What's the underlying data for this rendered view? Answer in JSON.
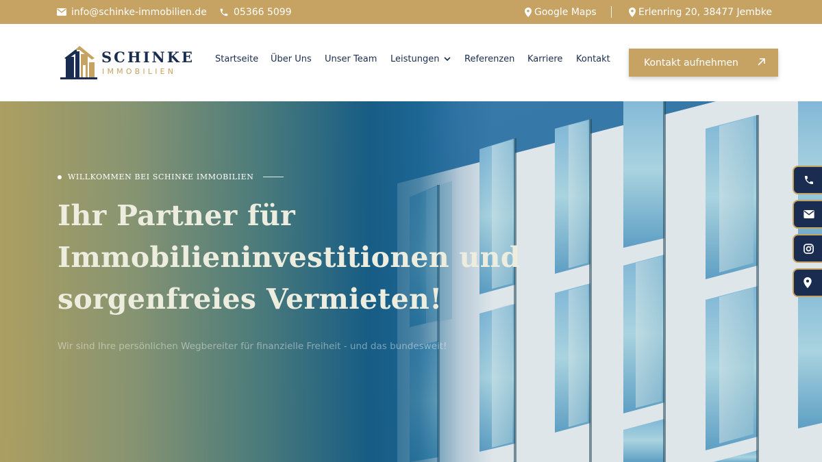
{
  "topbar": {
    "email": "info@schinke-immobilien.de",
    "phone": "05366 5099",
    "maps_label": "Google Maps",
    "address": "Erlenring 20, 38477 Jembke",
    "icons": {
      "email": "envelope-icon",
      "phone": "phone-icon",
      "maps": "map-pin-icon",
      "address": "map-pin-icon"
    }
  },
  "logo": {
    "name": "SCHINKE",
    "sub": "IMMOBILIEN"
  },
  "nav": {
    "items": [
      {
        "label": "Startseite"
      },
      {
        "label": "Über Uns"
      },
      {
        "label": "Unser Team"
      },
      {
        "label": "Leistungen"
      },
      {
        "label": "Referenzen"
      },
      {
        "label": "Karriere"
      },
      {
        "label": "Kontakt"
      }
    ],
    "dropdown_icon": "chevron-down-icon"
  },
  "cta": {
    "label": "Kontakt aufnehmen",
    "icon": "arrow-up-right-icon"
  },
  "hero": {
    "eyebrow": "WILLKOMMEN BEI SCHINKE IMMOBILIEN",
    "headline_lines": [
      "Ihr Partner für",
      "Immobilieninvestitionen und",
      "sorgenfreies Vermieten!"
    ],
    "subline": "Wir sind Ihre persönlichen Wegbereiter für finanzielle Freiheit - und das bundesweit!"
  },
  "side_buttons": [
    "phone-icon",
    "envelope-icon",
    "instagram-icon",
    "map-pin-icon"
  ],
  "colors": {
    "gold": "#c6a263",
    "navy": "#1a2c4f",
    "white": "#ffffff"
  }
}
